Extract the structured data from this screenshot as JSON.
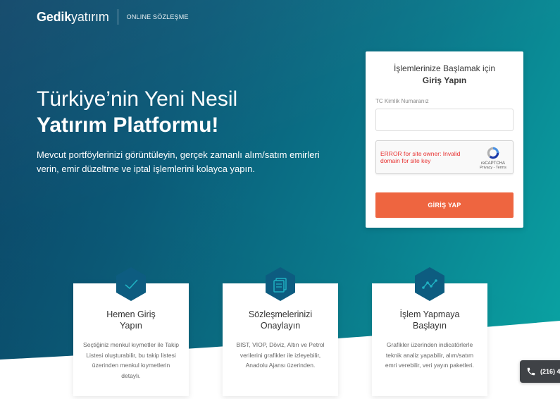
{
  "header": {
    "logo_bold": "Gedik",
    "logo_light": "yatırım",
    "subtitle": "ONLINE SÖZLEŞME"
  },
  "hero": {
    "title_line1": "Türkiye’nin Yeni Nesil",
    "title_line2": "Yatırım Platformu!",
    "description": "Mevcut portföylerinizi görüntüleyin, gerçek zamanlı alım/satım emirleri verin, emir düzeltme ve iptal işlemlerini kolayca yapın."
  },
  "login": {
    "heading_line1": "İşlemlerinize Başlamak için",
    "heading_line2": "Giriş Yapın",
    "tc_label": "TC Kimlik Numaranız",
    "tc_value": "",
    "captcha_error": "ERROR for site owner: Invalid domain for site key",
    "captcha_brand": "reCAPTCHA",
    "captcha_links": "Privacy - Terms",
    "submit_label": "GİRİŞ YAP"
  },
  "features": [
    {
      "icon": "check-icon",
      "title_line1": "Hemen Giriş",
      "title_line2": "Yapın",
      "text": "Seçtiğiniz menkul kıymetler ile Takip Listesi oluşturabilir, bu takip listesi üzerinden menkul kıymetlerin detaylı."
    },
    {
      "icon": "document-icon",
      "title_line1": "Sözleşmelerinizi",
      "title_line2": "Onaylayın",
      "text": "BIST, VIOP, Döviz, Altın ve Petrol verilerini grafikler ile izleyebilir, Anadolu Ajansı üzerinden."
    },
    {
      "icon": "chart-line-icon",
      "title_line1": "İşlem Yapmaya",
      "title_line2": "Başlayın",
      "text": "Grafikler üzerinden indicatörlerle teknik analiz yapabilir, alım/satım emri verebilir, veri yayın paketleri."
    }
  ],
  "contact": {
    "phone_partial": "(216) 4",
    "icon": "phone-icon"
  },
  "colors": {
    "accent": "#ee6540",
    "hex_badge": "#0d5c80",
    "error": "#e8302f"
  }
}
